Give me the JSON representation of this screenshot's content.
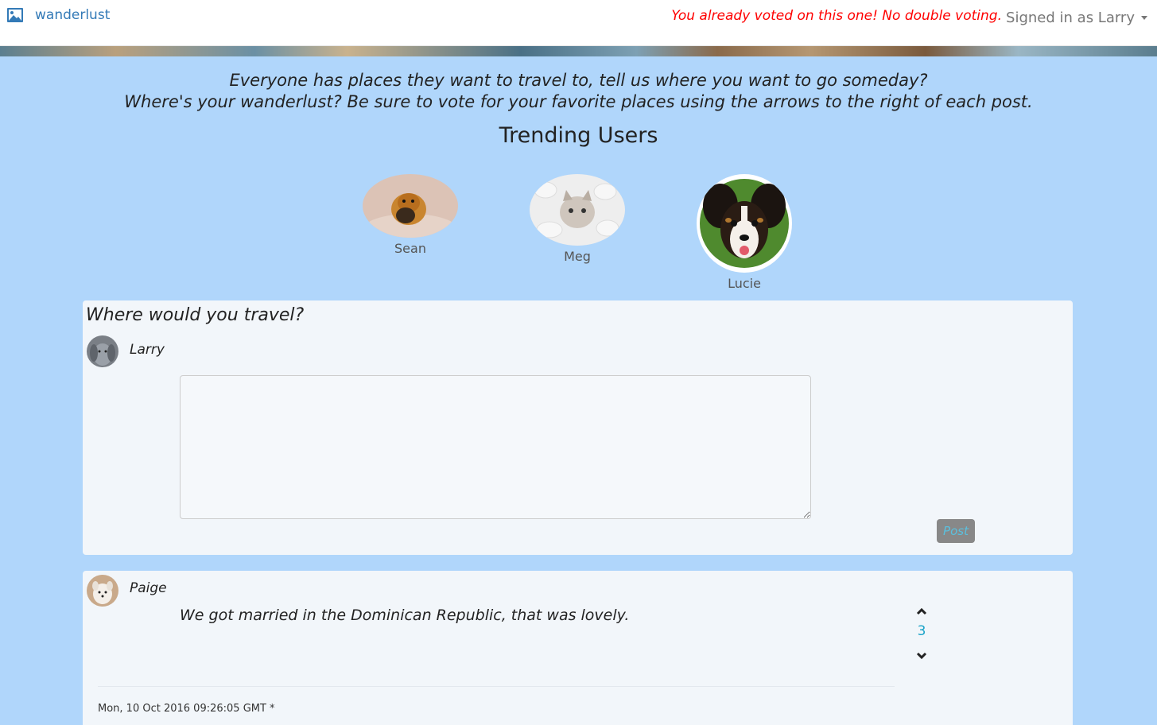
{
  "navbar": {
    "brand": "wanderlust",
    "brand_icon": "image-icon",
    "alert": "You already voted on this one! No double voting.",
    "signed_in": "Signed in as Larry"
  },
  "intro": {
    "line1": "Everyone has places they want to travel to, tell us where you want to go someday?",
    "line2": "Where's your wanderlust? Be sure to vote for your favorite places using the arrows to the right of each post."
  },
  "trending": {
    "title": "Trending Users",
    "users": [
      {
        "name": "Sean"
      },
      {
        "name": "Meg"
      },
      {
        "name": "Lucie"
      }
    ]
  },
  "compose": {
    "title": "Where would you travel?",
    "author": "Larry",
    "textarea_value": "",
    "post_label": "Post"
  },
  "post": {
    "author": "Paige",
    "text": "We got married in the Dominican Republic, that was lovely.",
    "votes": "3",
    "timestamp": "Mon, 10 Oct 2016 09:26:05 GMT *"
  },
  "colors": {
    "background": "#b0d6fb",
    "card": "#f2f6fa",
    "alert": "#ff0000",
    "link": "#337ab7",
    "vote_count": "#1aa3c8"
  }
}
